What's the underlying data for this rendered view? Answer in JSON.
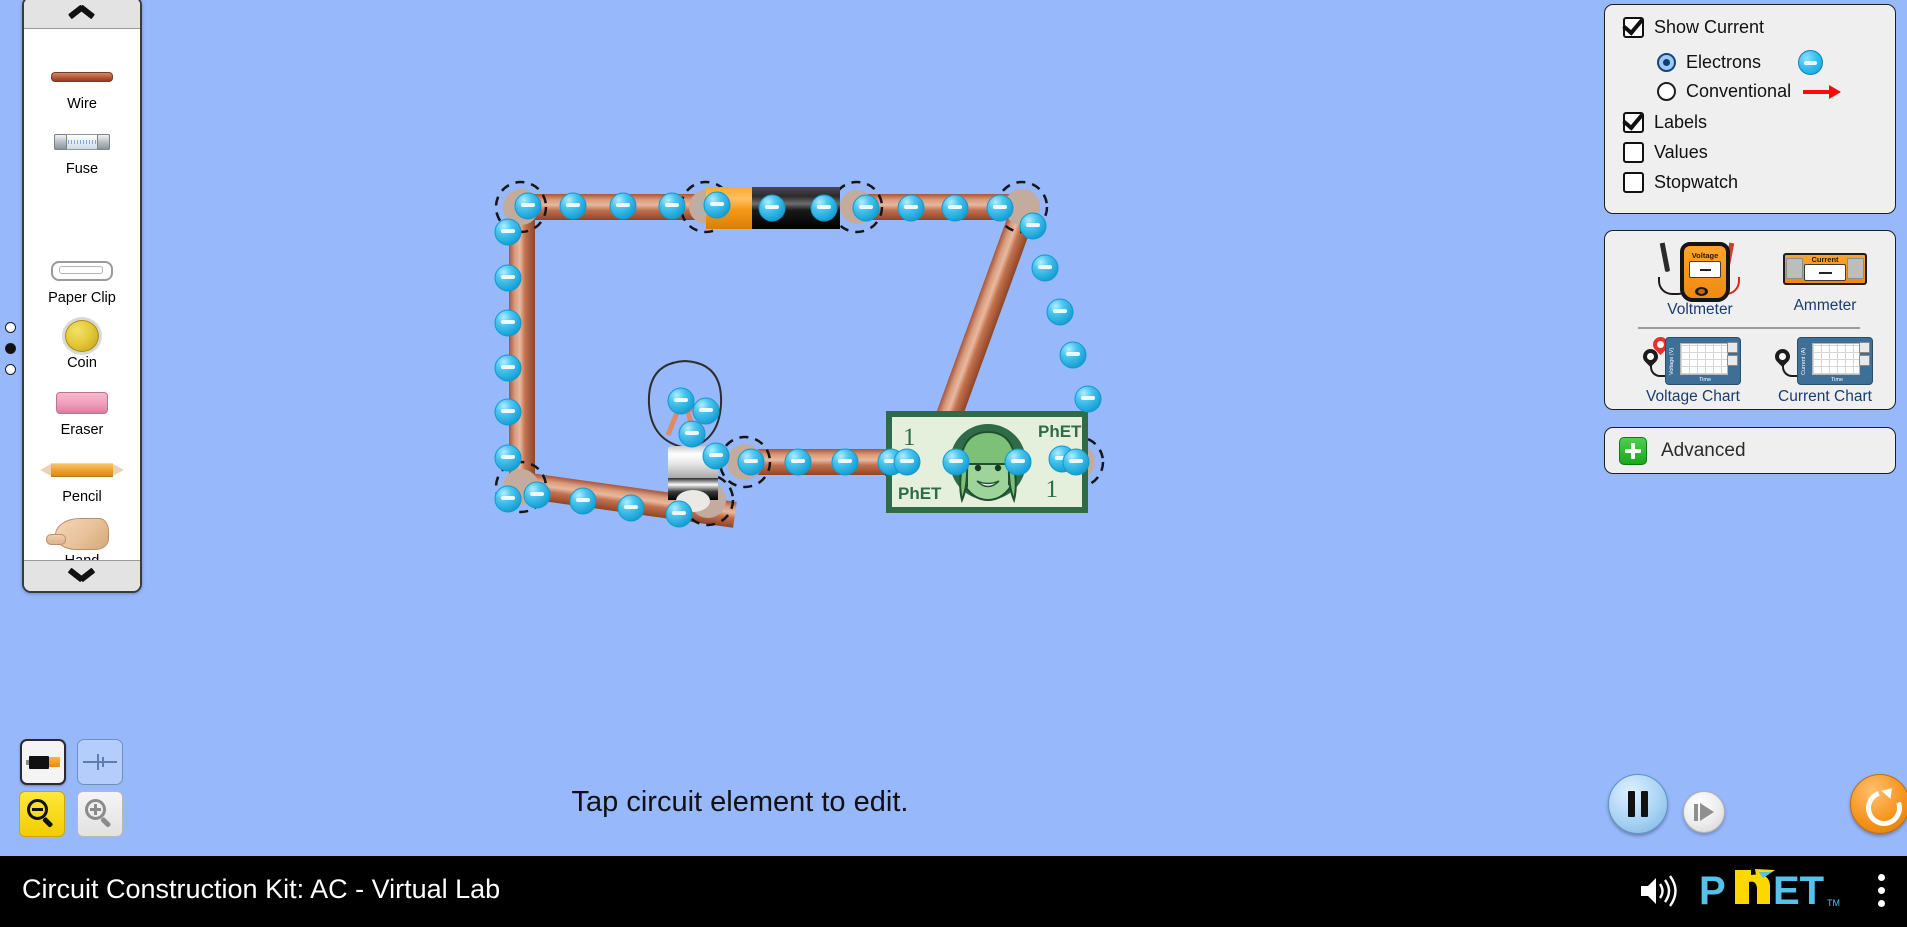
{
  "app": {
    "title": "Circuit Construction Kit: AC - Virtual Lab",
    "background_color": "#97b8fb",
    "hint": "Tap circuit element to edit."
  },
  "toolbox": {
    "up_arrow_icon": "chevron-up-icon",
    "down_arrow_icon": "chevron-down-icon",
    "items": [
      {
        "label": "Wire",
        "icon": "wire-icon"
      },
      {
        "label": "Fuse",
        "icon": "fuse-icon"
      },
      {
        "label": "Paper Clip",
        "icon": "paper-clip-icon"
      },
      {
        "label": "Coin",
        "icon": "coin-icon"
      },
      {
        "label": "Eraser",
        "icon": "eraser-icon"
      },
      {
        "label": "Pencil",
        "icon": "pencil-icon"
      },
      {
        "label": "Hand",
        "icon": "hand-icon"
      }
    ],
    "page_dots": {
      "count": 3,
      "active_index": 1
    }
  },
  "view_controls": {
    "lifelike": {
      "icon": "battery-lifelike-icon",
      "selected": true
    },
    "schematic": {
      "icon": "battery-schematic-icon",
      "selected": false
    },
    "zoom_out": {
      "icon": "zoom-out-icon",
      "selected": true
    },
    "zoom_in": {
      "icon": "zoom-in-icon",
      "selected": false
    }
  },
  "display_panel": {
    "show_current": {
      "label": "Show Current",
      "checked": true
    },
    "current_type": {
      "selected": "Electrons",
      "options": [
        {
          "label": "Electrons",
          "selected": true,
          "icon": "electron-chip-icon"
        },
        {
          "label": "Conventional",
          "selected": false,
          "icon": "red-arrow-icon"
        }
      ]
    },
    "labels": {
      "label": "Labels",
      "checked": true
    },
    "values": {
      "label": "Values",
      "checked": false
    },
    "stopwatch": {
      "label": "Stopwatch",
      "checked": false
    }
  },
  "sensor_panel": {
    "voltmeter": {
      "label": "Voltmeter",
      "screen_title": "Voltage",
      "reading": "—"
    },
    "ammeter": {
      "label": "Ammeter",
      "screen_title": "Current",
      "reading": "—"
    },
    "voltage_chart": {
      "label": "Voltage Chart",
      "ylabel": "Voltage (V)",
      "xlabel": "Time"
    },
    "current_chart": {
      "label": "Current Chart",
      "ylabel": "Current (A)",
      "xlabel": "Time"
    }
  },
  "advanced_panel": {
    "label": "Advanced",
    "expand_icon": "plus-icon",
    "expanded": false
  },
  "time_controls": {
    "pause": {
      "icon": "pause-icon",
      "state": "paused"
    },
    "step": {
      "icon": "step-forward-icon"
    },
    "reset": {
      "icon": "reset-all-icon"
    }
  },
  "navbar": {
    "title": "Circuit Construction Kit: AC - Virtual Lab",
    "sound_icon": "sound-on-icon",
    "logo": "PhET",
    "logo_trademark": "TM",
    "kebab_icon": "kebab-menu-icon",
    "logo_colors": {
      "blue": "#56c1ea",
      "yellow": "#fdd700"
    }
  },
  "circuit": {
    "elements": [
      {
        "type": "wire",
        "name": "wire-top-left"
      },
      {
        "type": "battery",
        "name": "battery",
        "body_color": "#121212",
        "cap_color": "#f79b1b"
      },
      {
        "type": "wire",
        "name": "wire-top-right"
      },
      {
        "type": "wire",
        "name": "wire-right-diagonal"
      },
      {
        "type": "dollar-bill",
        "name": "dollar-bill",
        "corner_numbers": [
          "1",
          "1"
        ],
        "logo_text": "PhET",
        "paper_color": "#e4f0dc",
        "border_color": "#2f6b46"
      },
      {
        "type": "wire",
        "name": "wire-bottom-right"
      },
      {
        "type": "light-bulb",
        "name": "light-bulb"
      },
      {
        "type": "wire",
        "name": "wire-bottom-left"
      },
      {
        "type": "wire",
        "name": "wire-left"
      }
    ],
    "electron_color": "#3fc0ef",
    "wire_color": "#c06a48",
    "show_electrons": true
  }
}
